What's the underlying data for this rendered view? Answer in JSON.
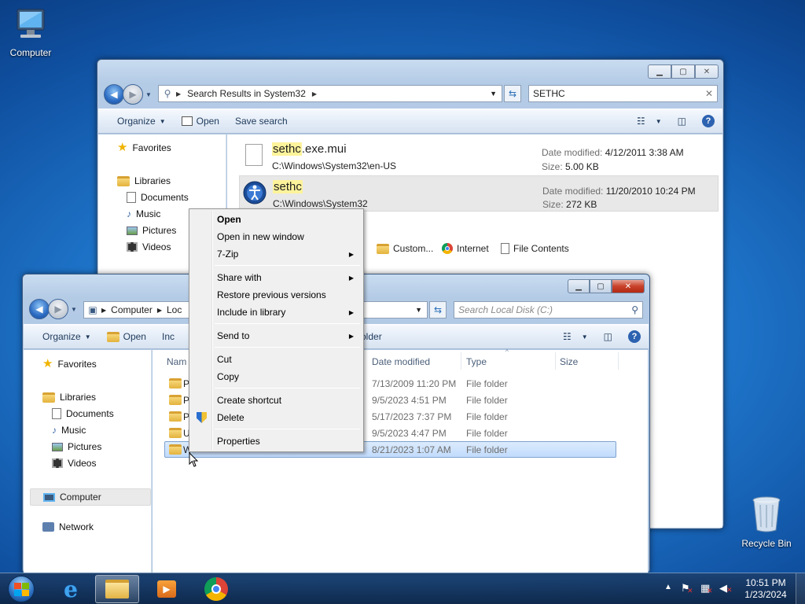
{
  "desktop": {
    "computer_label": "Computer",
    "recycle_label": "Recycle Bin"
  },
  "search_window": {
    "breadcrumb": "Search Results in System32",
    "search_value": "SETHC",
    "toolbar": {
      "organize": "Organize",
      "open": "Open",
      "save_search": "Save search"
    },
    "nav": {
      "favorites": "Favorites",
      "libraries": "Libraries",
      "documents": "Documents",
      "music": "Music",
      "pictures": "Pictures",
      "videos": "Videos"
    },
    "results": [
      {
        "name_highlight": "sethc",
        "name_rest": ".exe.mui",
        "path": "C:\\Windows\\System32\\en-US",
        "date_label": "Date modified:",
        "date": "4/12/2011 3:38 AM",
        "size_label": "Size:",
        "size": "5.00 KB"
      },
      {
        "name_highlight": "sethc",
        "name_rest": "",
        "path": "C:\\Windows\\System32",
        "date_label": "Date modified:",
        "date": "11/20/2010 10:24 PM",
        "size_label": "Size:",
        "size": "272 KB"
      }
    ],
    "search_again": {
      "custom": "Custom...",
      "internet": "Internet",
      "file_contents": "File Contents"
    }
  },
  "disk_window": {
    "breadcrumb_1": "Computer",
    "breadcrumb_2": "Loc",
    "search_placeholder": "Search Local Disk (C:)",
    "toolbar": {
      "organize": "Organize",
      "open": "Open",
      "include": "Inc",
      "new_folder": "ew folder"
    },
    "nav": {
      "favorites": "Favorites",
      "libraries": "Libraries",
      "documents": "Documents",
      "music": "Music",
      "pictures": "Pictures",
      "videos": "Videos",
      "computer": "Computer",
      "network": "Network"
    },
    "columns": {
      "name": "Nam",
      "date": "Date modified",
      "type": "Type",
      "size": "Size"
    },
    "rows": [
      {
        "name": "P",
        "date": "7/13/2009 11:20 PM",
        "type": "File folder"
      },
      {
        "name": "P",
        "date": "9/5/2023 4:51 PM",
        "type": "File folder"
      },
      {
        "name": "P",
        "date": "5/17/2023 7:37 PM",
        "type": "File folder"
      },
      {
        "name": "U",
        "date": "9/5/2023 4:47 PM",
        "type": "File folder"
      },
      {
        "name": "W",
        "date": "8/21/2023 1:07 AM",
        "type": "File folder"
      }
    ]
  },
  "context_menu": {
    "open": "Open",
    "open_new_window": "Open in new window",
    "seven_zip": "7-Zip",
    "share_with": "Share with",
    "restore_prev": "Restore previous versions",
    "include_library": "Include in library",
    "send_to": "Send to",
    "cut": "Cut",
    "copy": "Copy",
    "create_shortcut": "Create shortcut",
    "delete": "Delete",
    "properties": "Properties"
  },
  "taskbar": {
    "time": "10:51 PM",
    "date": "1/23/2024"
  }
}
